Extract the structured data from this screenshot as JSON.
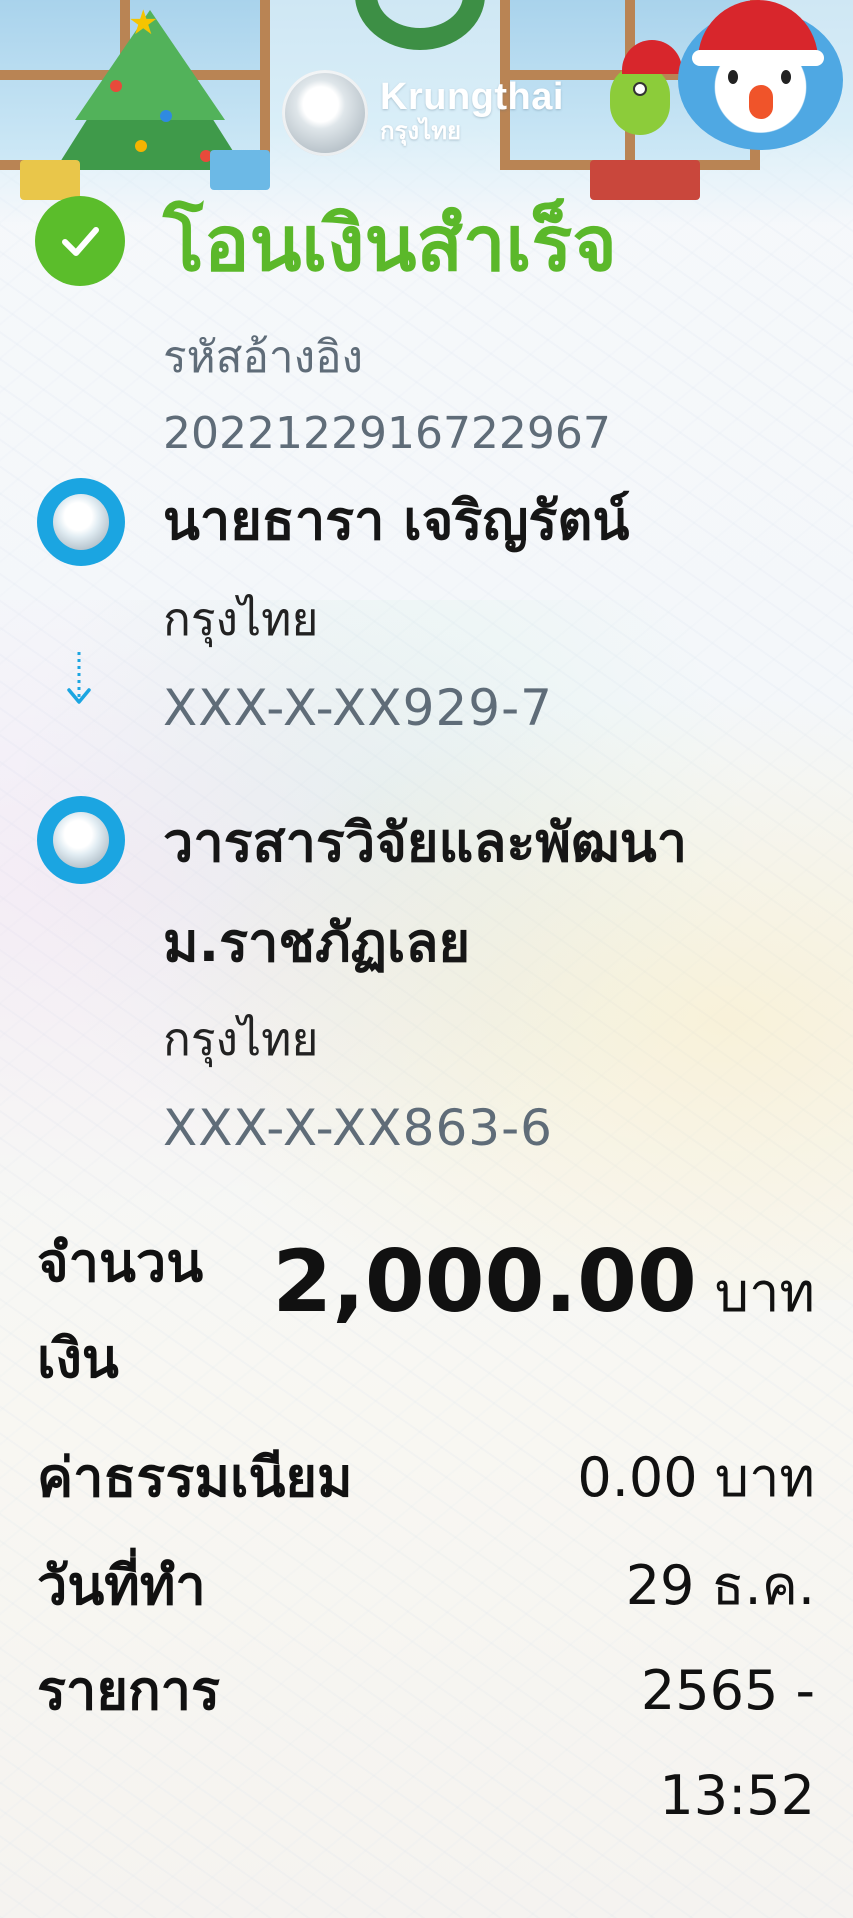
{
  "brand": {
    "name_en": "Krungthai",
    "name_th": "กรุงไทย"
  },
  "status": {
    "title": "โอนเงินสำเร็จ",
    "icon": "check-circle-icon",
    "color": "#5bbd2b"
  },
  "reference": {
    "label": "รหัสอ้างอิง",
    "value": "2022122916722967"
  },
  "sender": {
    "name": "นายธารา เจริญรัตน์",
    "bank": "กรุงไทย",
    "account": "XXX-X-XX929-7",
    "icon": "krungthai-bank-icon"
  },
  "receiver": {
    "name_line1": "วารสารวิจัยและพัฒนา",
    "name_line2": "ม.ราชภัฏเลย",
    "bank": "กรุงไทย",
    "account": "XXX-X-XX863-6",
    "icon": "krungthai-bank-icon"
  },
  "details": {
    "amount_label_line1": "จำนวน",
    "amount_label_line2": "เงิน",
    "amount_value": "2,000.00",
    "amount_unit": "บาท",
    "fee_label": "ค่าธรรมเนียม",
    "fee_value": "0.00 บาท",
    "date_label_line1": "วันที่ทำ",
    "date_label_line2": "รายการ",
    "date_line1": "29 ธ.ค.",
    "date_line2": "2565 -",
    "date_line3": "13:52"
  },
  "colors": {
    "accent_green": "#5bb82a",
    "bank_blue": "#1ba5e1",
    "muted_text": "#5f6c78"
  }
}
